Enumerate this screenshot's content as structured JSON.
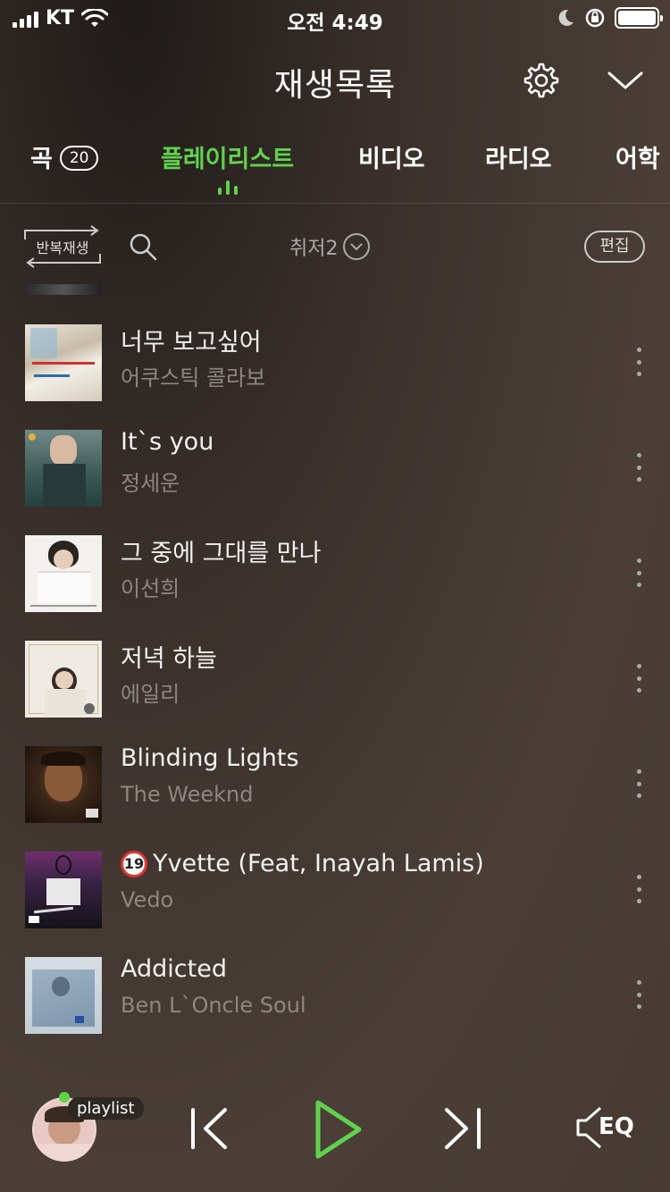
{
  "status_bar": {
    "carrier": "KT",
    "time": "오전 4:49"
  },
  "header": {
    "title": "재생목록"
  },
  "tabs": [
    {
      "label": "곡",
      "count": "20"
    },
    {
      "label": "플레이리스트"
    },
    {
      "label": "비디오"
    },
    {
      "label": "라디오"
    },
    {
      "label": "어학"
    }
  ],
  "toolbar": {
    "repeat_label": "반복재생",
    "sort_label": "취저2",
    "edit_label": "편집"
  },
  "songs": [
    {
      "title": "너무 보고싶어",
      "artist": "어쿠스틱 콜라보"
    },
    {
      "title": "It`s you",
      "artist": "정세운"
    },
    {
      "title": "그 중에 그대를 만나",
      "artist": "이선희"
    },
    {
      "title": "저녁 하늘",
      "artist": "에일리"
    },
    {
      "title": "Blinding Lights",
      "artist": "The Weeknd"
    },
    {
      "title": "Yvette (Feat, Inayah Lamis)",
      "artist": "Vedo",
      "age_badge": "19"
    },
    {
      "title": "Addicted",
      "artist": "Ben L`Oncle Soul"
    }
  ],
  "player": {
    "badge": "playlist",
    "eq_label": "EQ"
  },
  "colors": {
    "accent": "#62d24e",
    "age_badge": "#e23333"
  }
}
